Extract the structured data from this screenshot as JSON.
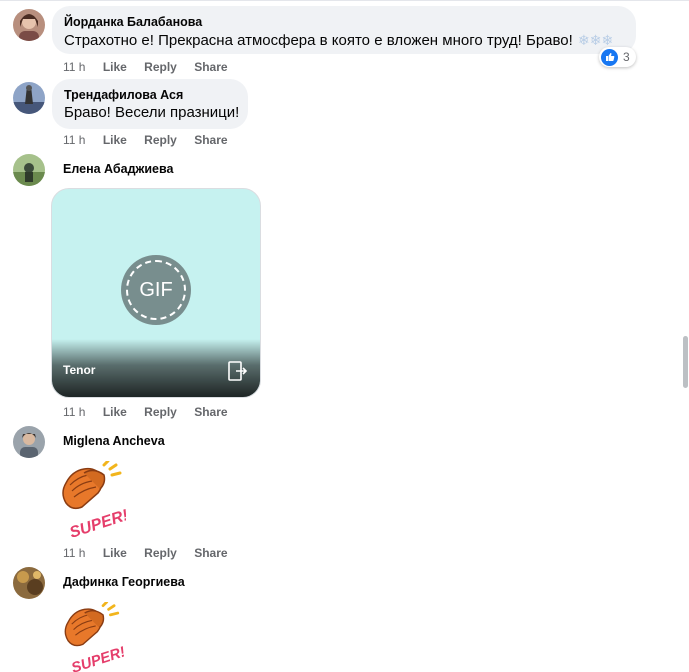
{
  "comments": [
    {
      "author": "Йорданка Балабанова",
      "text": "Страхотно е! Прекрасна атмосфера в която е вложен много труд! Браво!",
      "time": "11 h",
      "like": "Like",
      "reply": "Reply",
      "share": "Share",
      "reaction_count": "3"
    },
    {
      "author": "Трендафилова Ася",
      "text": "Браво! Весели празници!",
      "time": "11 h",
      "like": "Like",
      "reply": "Reply",
      "share": "Share"
    },
    {
      "author": "Елена Абаджиева",
      "gif_label": "GIF",
      "gif_provider": "Tenor",
      "time": "11 h",
      "like": "Like",
      "reply": "Reply",
      "share": "Share"
    },
    {
      "author": "Miglena Ancheva",
      "sticker_text": "SUPER!",
      "time": "11 h",
      "like": "Like",
      "reply": "Reply",
      "share": "Share"
    },
    {
      "author": "Дафинка Георгиева",
      "sticker_text": "SUPER!"
    }
  ],
  "colors": {
    "bubble": "#f0f2f5",
    "meta": "#65676b",
    "like_blue": "#1877f2",
    "gif_bg": "#c6f2f0"
  },
  "icons": [
    "snowflake-icon",
    "like-reaction-icon",
    "gif-icon",
    "external-link-icon",
    "clapping-hands-sticker"
  ]
}
